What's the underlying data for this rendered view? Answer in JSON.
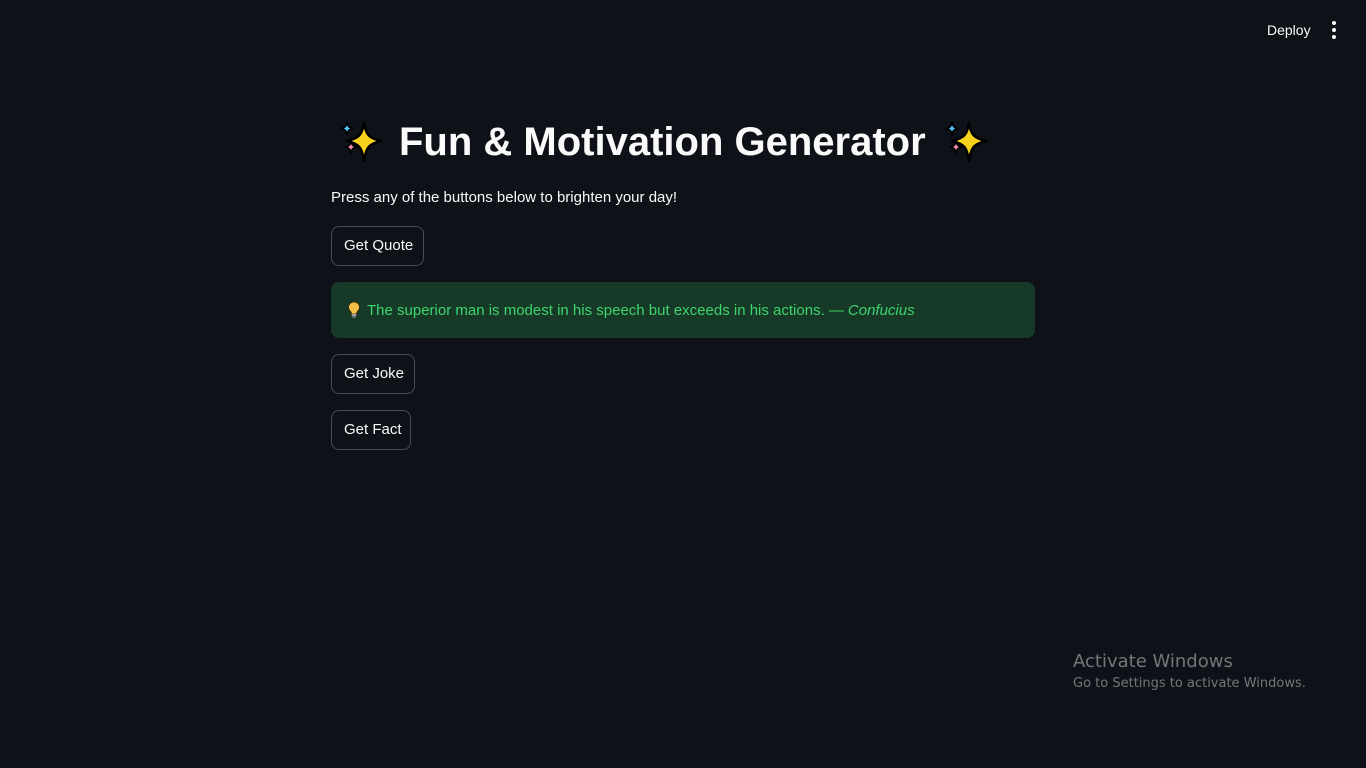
{
  "header": {
    "deploy_label": "Deploy",
    "menu_icon": "kebab-menu-icon"
  },
  "main": {
    "title": "Fun & Motivation Generator",
    "title_icon": "sparkles-icon",
    "subtitle": "Press any of the buttons below to brighten your day!",
    "buttons": {
      "quote": "Get Quote",
      "joke": "Get Joke",
      "fact": "Get Fact"
    },
    "result": {
      "icon": "lightbulb-icon",
      "text": "The superior man is modest in his speech but exceeds in his actions. —",
      "author": "Confucius",
      "background": "#173928",
      "color": "#3dd56d"
    }
  },
  "watermark": {
    "title": "Activate Windows",
    "subtitle": "Go to Settings to activate Windows."
  },
  "theme": {
    "background": "#0e1117",
    "text": "#fafafa"
  }
}
